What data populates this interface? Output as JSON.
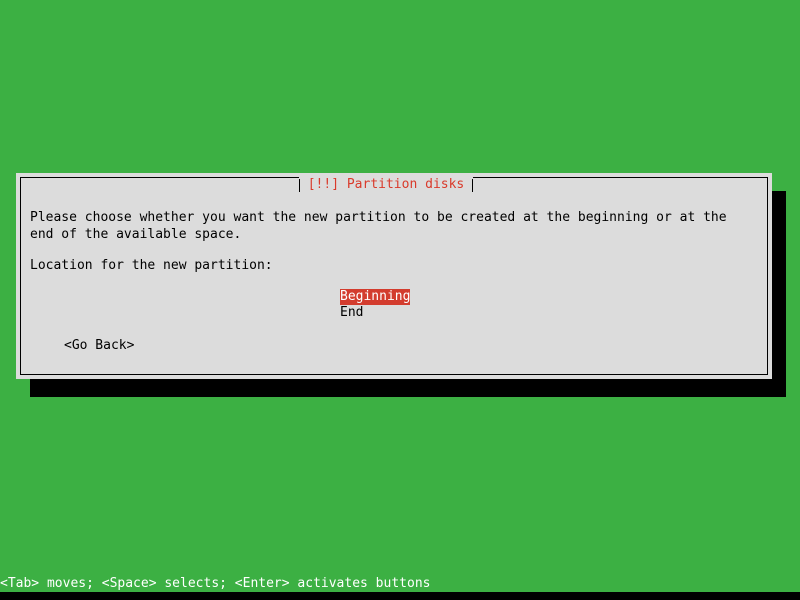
{
  "screen": {
    "background_color": "#3cb043",
    "text_color": "#ffffff"
  },
  "dialog": {
    "title": "[!!] Partition disks",
    "title_color": "#d93a2b",
    "background_color": "#dcdcdc",
    "border_color": "#000000",
    "body_text": "Please choose whether you want the new partition to be created at the beginning or at the\nend of the available space.",
    "prompt_label": "Location for the new partition:",
    "choices": [
      {
        "label": "Beginning",
        "selected": true
      },
      {
        "label": "End",
        "selected": false
      }
    ],
    "selection_highlight_color": "#d33c2e",
    "selection_text_color": "#ffffff",
    "buttons": [
      {
        "label": "<Go Back>"
      }
    ]
  },
  "statusbar": {
    "text": "<Tab> moves; <Space> selects; <Enter> activates buttons"
  }
}
